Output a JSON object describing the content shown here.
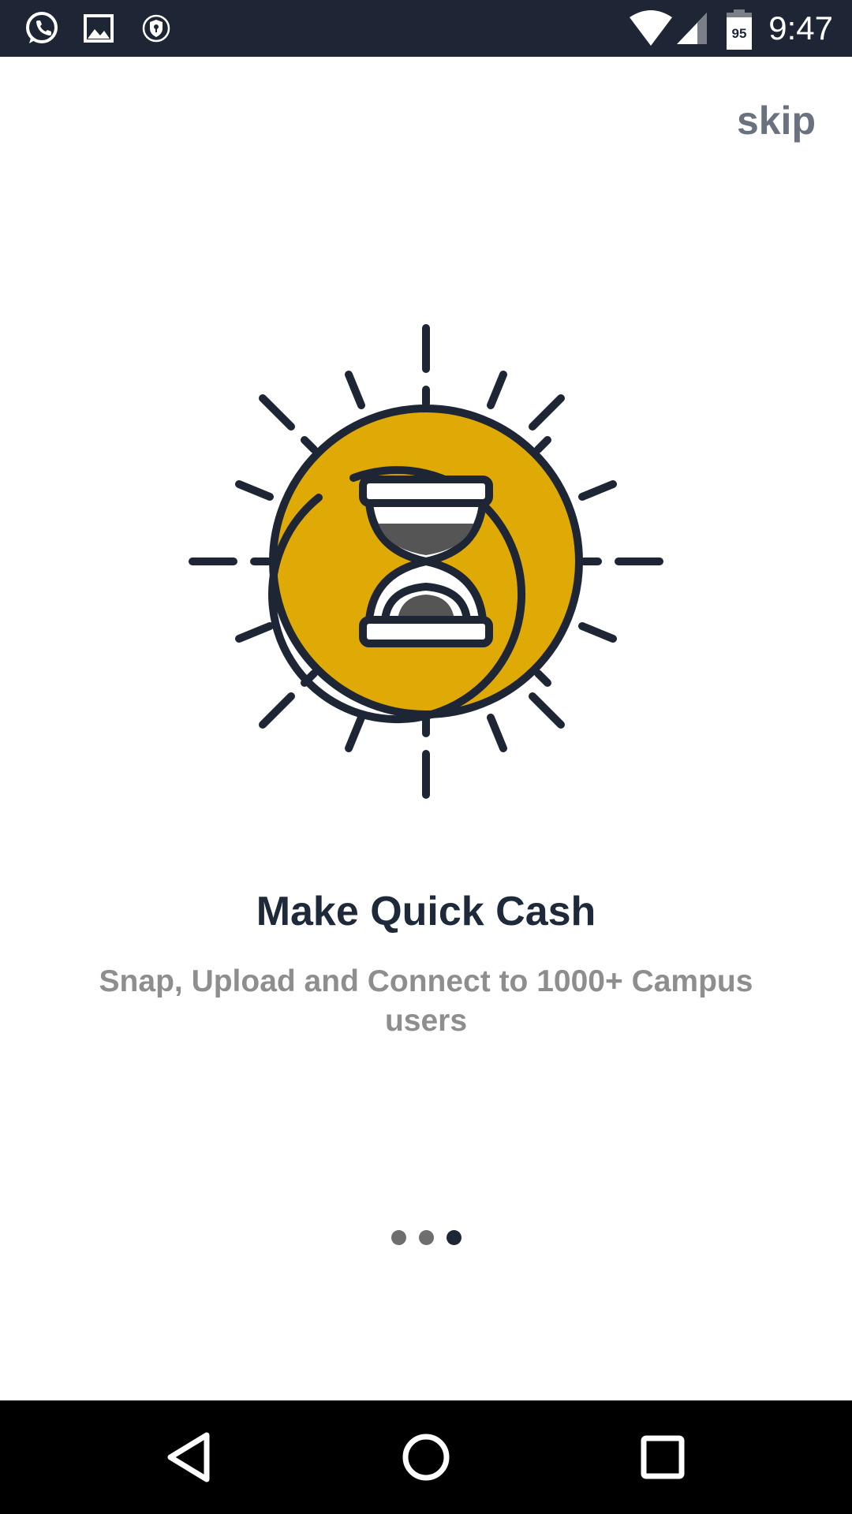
{
  "status_bar": {
    "time": "9:47",
    "battery_level": "95",
    "icons": [
      "whatsapp-icon",
      "gallery-icon",
      "vpn-shield-icon",
      "wifi-icon",
      "cell-signal-icon",
      "battery-icon"
    ]
  },
  "onboarding": {
    "skip_label": "skip",
    "title": "Make Quick Cash",
    "subtitle": "Snap, Upload and Connect to 1000+ Campus users",
    "illustration": "hourglass-coin-icon",
    "page_count": 3,
    "active_page": 3
  },
  "colors": {
    "status_bar_bg": "#1e2636",
    "coin_gold": "#e0aa06",
    "outline_dark": "#1e2636",
    "title": "#1e2a3a",
    "subtitle": "#8e8e8e",
    "skip": "#6a7280"
  },
  "nav_bar": {
    "buttons": [
      "back-icon",
      "home-icon",
      "recents-icon"
    ]
  }
}
